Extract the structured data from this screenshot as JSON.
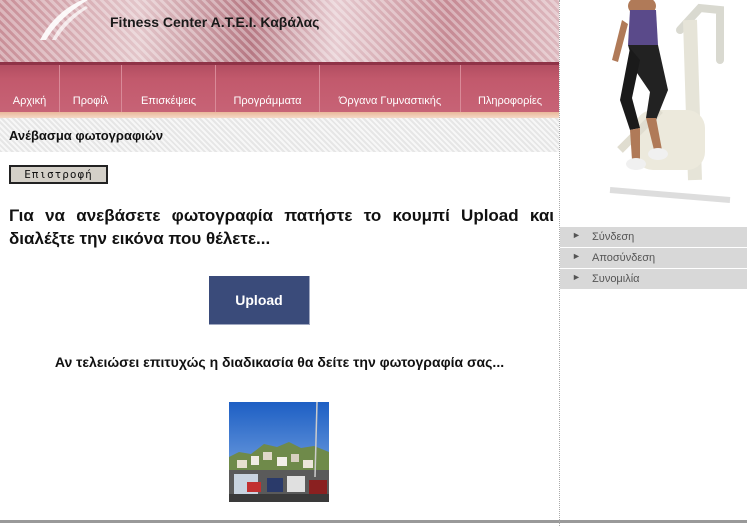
{
  "header": {
    "title": "Fitness Center A.T.E.I. Καβάλας"
  },
  "nav": {
    "items": [
      {
        "label": "Αρχική"
      },
      {
        "label": "Προφίλ"
      },
      {
        "label": "Επισκέψεις"
      },
      {
        "label": "Προγράμματα"
      },
      {
        "label": "Όργανα Γυμναστικής"
      },
      {
        "label": "Πληροφορίες"
      }
    ]
  },
  "section": {
    "title": "Ανέβασμα φωτογραφιών"
  },
  "main": {
    "back_label": "Επιστροφή",
    "instructions": "Για να ανεβάσετε φωτογραφία πατήστε το κουμπί Upload και διαλέξτε την εικόνα που θέλετε...",
    "upload_label": "Upload",
    "result_note": "Αν τελειώσει επιτυχώς η διαδικασία θα δείτε την φωτογραφία σας..."
  },
  "sidebar": {
    "menu": [
      {
        "label": "Σύνδεση",
        "icon": "arrow-right-icon"
      },
      {
        "label": "Αποσύνδεση",
        "icon": "arrow-right-icon"
      },
      {
        "label": "Συνομιλία",
        "icon": "arrow-right-icon"
      }
    ]
  },
  "colors": {
    "nav_bg": "#c2596c",
    "upload_button": "#3a4b7a",
    "sidebar_menu_bg": "#d8d8d8"
  }
}
